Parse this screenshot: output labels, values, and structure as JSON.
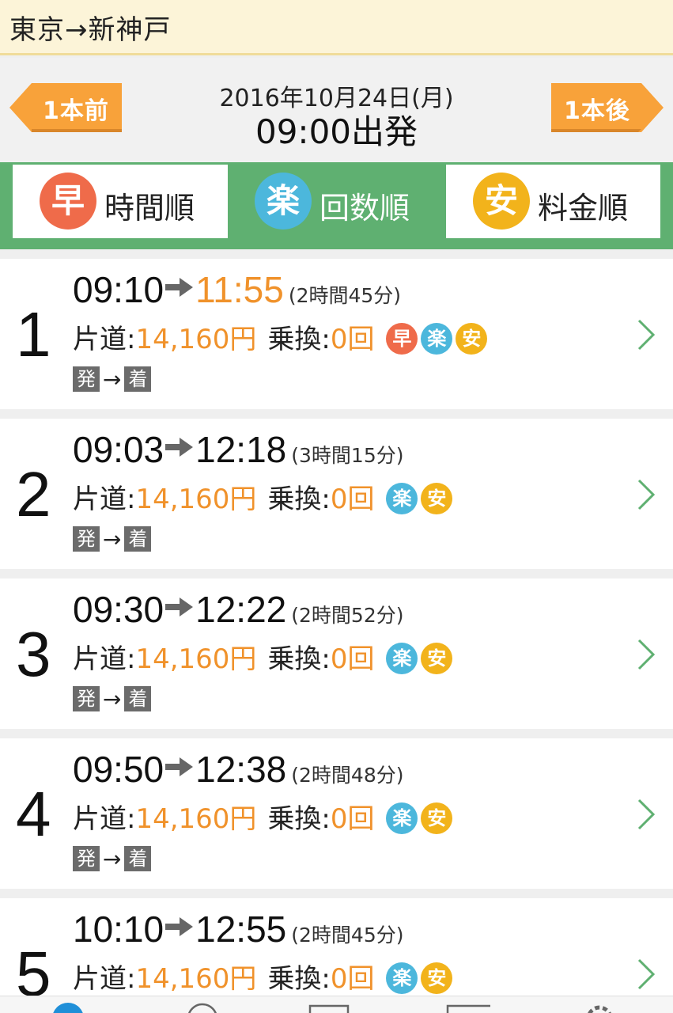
{
  "route": {
    "title": "東京→新神戸"
  },
  "nav": {
    "prev_label": "1本前",
    "next_label": "1本後",
    "date": "2016年10月24日(月)",
    "departure": "09:00出発"
  },
  "tabs": [
    {
      "badge": "早",
      "label": "時間順",
      "color": "#ef6b4a"
    },
    {
      "badge": "楽",
      "label": "回数順",
      "color": "#4cb7dc"
    },
    {
      "badge": "安",
      "label": "料金順",
      "color": "#f2b31b"
    }
  ],
  "labels": {
    "fare": "片道:",
    "transfer": "乗換:",
    "dep_tag": "発",
    "arr_tag": "着",
    "tag_arrow": "→"
  },
  "results": [
    {
      "rank": "1",
      "dep": "09:10",
      "arr": "11:55",
      "duration": "(2時間45分)",
      "fare": "14,160円",
      "transfers": "0回",
      "badges": [
        "早",
        "楽",
        "安"
      ]
    },
    {
      "rank": "2",
      "dep": "09:03",
      "arr": "12:18",
      "duration": "(3時間15分)",
      "fare": "14,160円",
      "transfers": "0回",
      "badges": [
        "楽",
        "安"
      ]
    },
    {
      "rank": "3",
      "dep": "09:30",
      "arr": "12:22",
      "duration": "(2時間52分)",
      "fare": "14,160円",
      "transfers": "0回",
      "badges": [
        "楽",
        "安"
      ]
    },
    {
      "rank": "4",
      "dep": "09:50",
      "arr": "12:38",
      "duration": "(2時間48分)",
      "fare": "14,160円",
      "transfers": "0回",
      "badges": [
        "楽",
        "安"
      ]
    },
    {
      "rank": "5",
      "dep": "10:10",
      "arr": "12:55",
      "duration": "(2時間45分)",
      "fare": "14,160円",
      "transfers": "0回",
      "badges": [
        "楽",
        "安"
      ]
    }
  ],
  "colors": {
    "accent_green": "#5fb071",
    "orange": "#f0922b",
    "nav_orange": "#f8a23a"
  }
}
